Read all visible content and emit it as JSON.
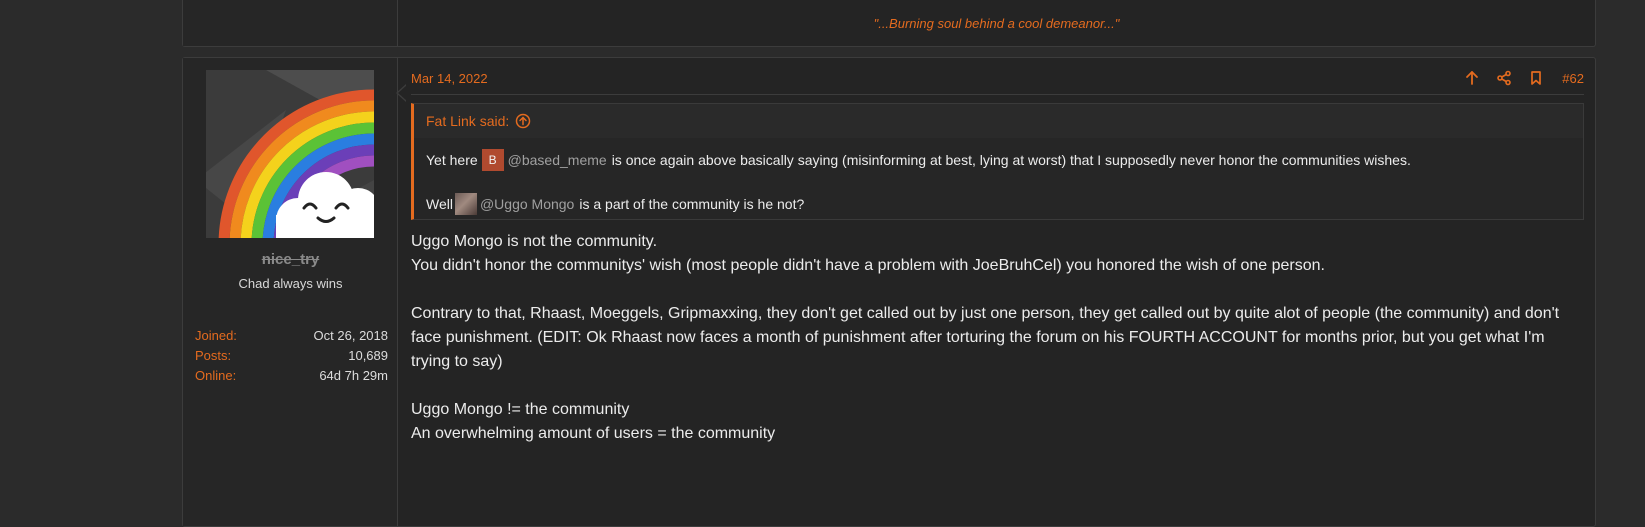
{
  "previous_post": {
    "signature": "\"...Burning soul behind a cool demeanor...\""
  },
  "user": {
    "name": "nice_try",
    "title": "Chad always wins",
    "stats": [
      {
        "label": "Joined:",
        "value": "Oct 26, 2018"
      },
      {
        "label": "Posts:",
        "value": "10,689"
      },
      {
        "label": "Online:",
        "value": "64d 7h 29m"
      }
    ]
  },
  "post": {
    "date": "Mar 14, 2022",
    "number": "#62",
    "quote": {
      "author": "Fat Link said:",
      "line1_pre": "Yet here",
      "line1_avatar_letter": "B",
      "line1_mention": "@based_meme",
      "line1_post": "is once again above basically saying (misinforming at best, lying at worst) that I supposedly never honor the communities wishes.",
      "line2_pre": "Well",
      "line2_mention": "@Uggo Mongo",
      "line2_post": "is a part of the community is he not?"
    },
    "body": [
      "Uggo Mongo is not the community.",
      "You didn't honor the communitys' wish (most people didn't have a problem with JoeBruhCel) you honored the wish of one person.",
      "",
      "Contrary to that, Rhaast, Moeggels, Gripmaxxing, they don't get called out by just one person, they get called out by quite alot of people (the community) and don't face punishment. (EDIT: Ok Rhaast now faces a month of punishment after torturing the forum on his FOURTH ACCOUNT for months prior, but you get what I'm trying to say)",
      "",
      "Uggo Mongo != the community",
      "An overwhelming amount of users = the community"
    ]
  },
  "colors": {
    "accent": "#e46b1f",
    "background": "#2b2b2b",
    "panel": "#242424"
  },
  "icons": [
    "up-arrow-icon",
    "share-icon",
    "bookmark-icon",
    "circle-up-arrow-icon"
  ]
}
